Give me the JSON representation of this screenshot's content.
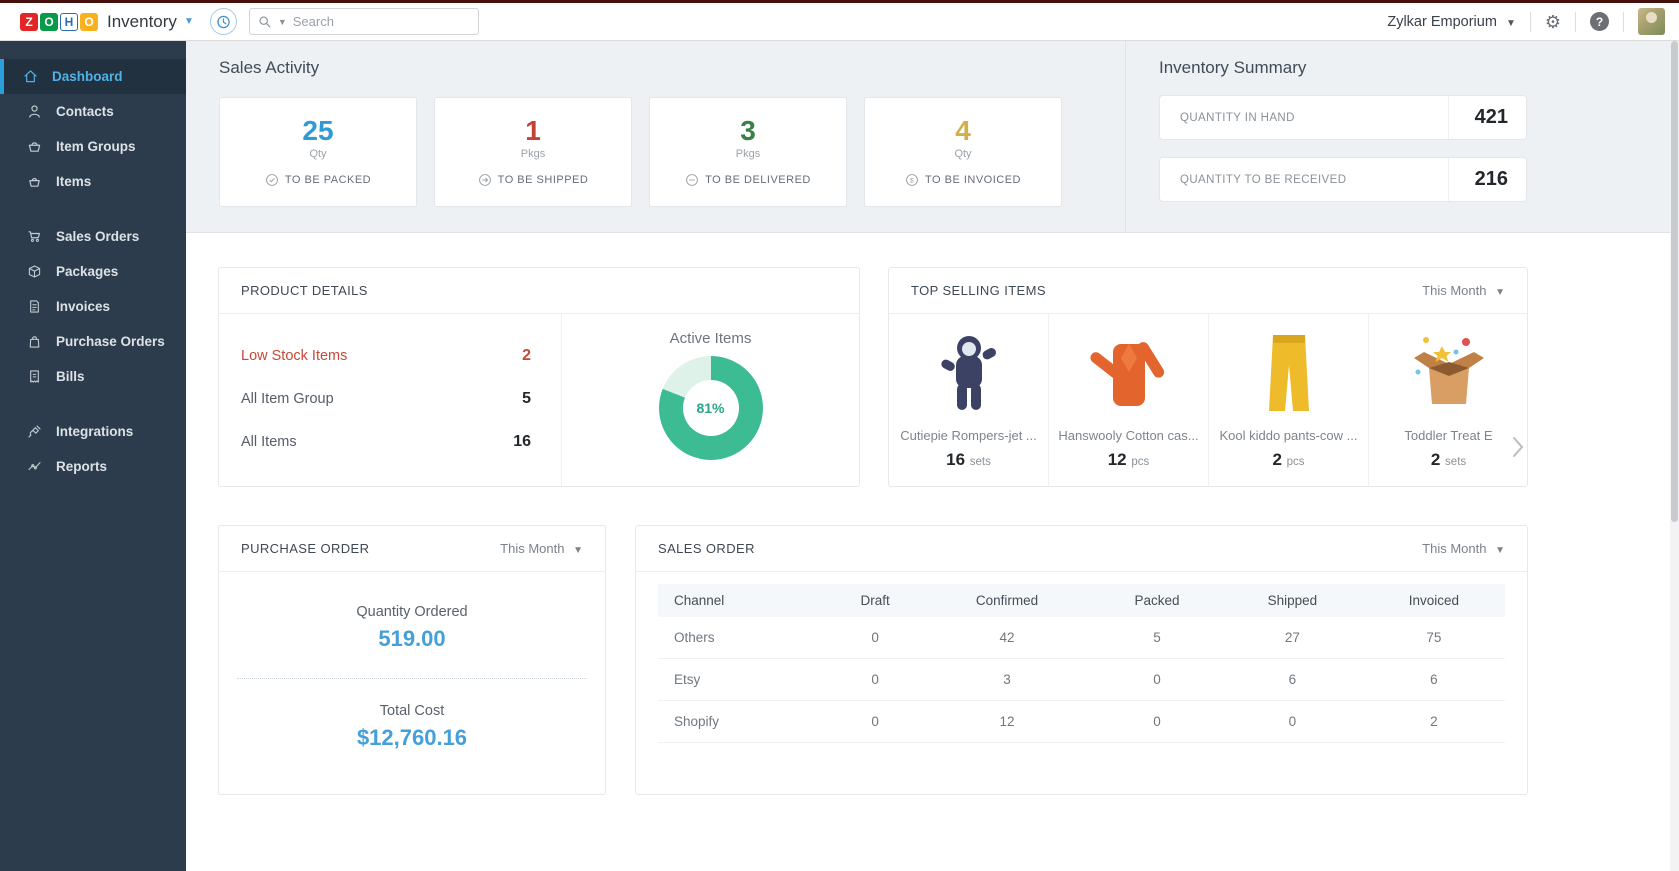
{
  "topbar": {
    "logo": {
      "letters": [
        {
          "ch": "Z",
          "bg": "#e42527",
          "fg": "#ffffff"
        },
        {
          "ch": "O",
          "bg": "#089949",
          "fg": "#ffffff"
        },
        {
          "ch": "H",
          "bg": "#ffffff",
          "fg": "#2a6db0"
        },
        {
          "ch": "O",
          "bg": "#f9b21d",
          "fg": "#ffffff"
        }
      ],
      "app_name": "Inventory"
    },
    "search": {
      "placeholder": "Search"
    },
    "org_name": "Zylkar Emporium",
    "help_glyph": "?",
    "gear_glyph": "⚙"
  },
  "sidebar": {
    "items": [
      {
        "label": "Dashboard"
      },
      {
        "label": "Contacts"
      },
      {
        "label": "Item Groups"
      },
      {
        "label": "Items"
      },
      {
        "label": "Sales Orders"
      },
      {
        "label": "Packages"
      },
      {
        "label": "Invoices"
      },
      {
        "label": "Purchase Orders"
      },
      {
        "label": "Bills"
      },
      {
        "label": "Integrations"
      },
      {
        "label": "Reports"
      }
    ],
    "active_item": "Dashboard"
  },
  "sales_activity": {
    "title": "Sales Activity",
    "cards": [
      {
        "value": "25",
        "unit": "Qty",
        "label": "TO BE PACKED",
        "accent": "#2f9bd6"
      },
      {
        "value": "1",
        "unit": "Pkgs",
        "label": "TO BE SHIPPED",
        "accent": "#bf4537"
      },
      {
        "value": "3",
        "unit": "Pkgs",
        "label": "TO BE DELIVERED",
        "accent": "#3a7f47"
      },
      {
        "value": "4",
        "unit": "Qty",
        "label": "TO BE INVOICED",
        "accent": "#d2af4a"
      }
    ]
  },
  "inventory_summary": {
    "title": "Inventory Summary",
    "rows": [
      {
        "label": "QUANTITY IN HAND",
        "value": "421"
      },
      {
        "label": "QUANTITY TO BE RECEIVED",
        "value": "216"
      }
    ]
  },
  "product_details": {
    "title": "PRODUCT DETAILS",
    "rows": [
      {
        "label": "Low Stock Items",
        "value": "2"
      },
      {
        "label": "All Item Group",
        "value": "5"
      },
      {
        "label": "All Items",
        "value": "16"
      }
    ],
    "low_stock_color": "#c44a38"
  },
  "chart_data": {
    "type": "pie",
    "title": "Active Items",
    "labels": [
      "Active",
      "Inactive"
    ],
    "values": [
      81,
      19
    ],
    "colors": [
      "#3dbc93",
      "#def2ea"
    ],
    "center_label": "81%",
    "legend": "none"
  },
  "top_selling": {
    "title": "TOP SELLING ITEMS",
    "period": "This Month",
    "items": [
      {
        "name": "Cutiepie Rompers-jet ...",
        "qty": "16",
        "unit": "sets"
      },
      {
        "name": "Hanswooly Cotton cas...",
        "qty": "12",
        "unit": "pcs"
      },
      {
        "name": "Kool kiddo pants-cow ...",
        "qty": "2",
        "unit": "pcs"
      },
      {
        "name": "Toddler Treat E",
        "qty": "2",
        "unit": "sets"
      }
    ]
  },
  "purchase_order": {
    "title": "PURCHASE ORDER",
    "period": "This Month",
    "quantity_label": "Quantity Ordered",
    "quantity_value": "519.00",
    "cost_label": "Total Cost",
    "cost_value": "$12,760.16",
    "accent": "#459fd9"
  },
  "sales_order": {
    "title": "SALES ORDER",
    "period": "This Month",
    "columns": [
      "Channel",
      "Draft",
      "Confirmed",
      "Packed",
      "Shipped",
      "Invoiced"
    ],
    "rows": [
      [
        "Others",
        "0",
        "42",
        "5",
        "27",
        "75"
      ],
      [
        "Etsy",
        "0",
        "3",
        "0",
        "6",
        "6"
      ],
      [
        "Shopify",
        "0",
        "12",
        "0",
        "0",
        "2"
      ]
    ]
  }
}
